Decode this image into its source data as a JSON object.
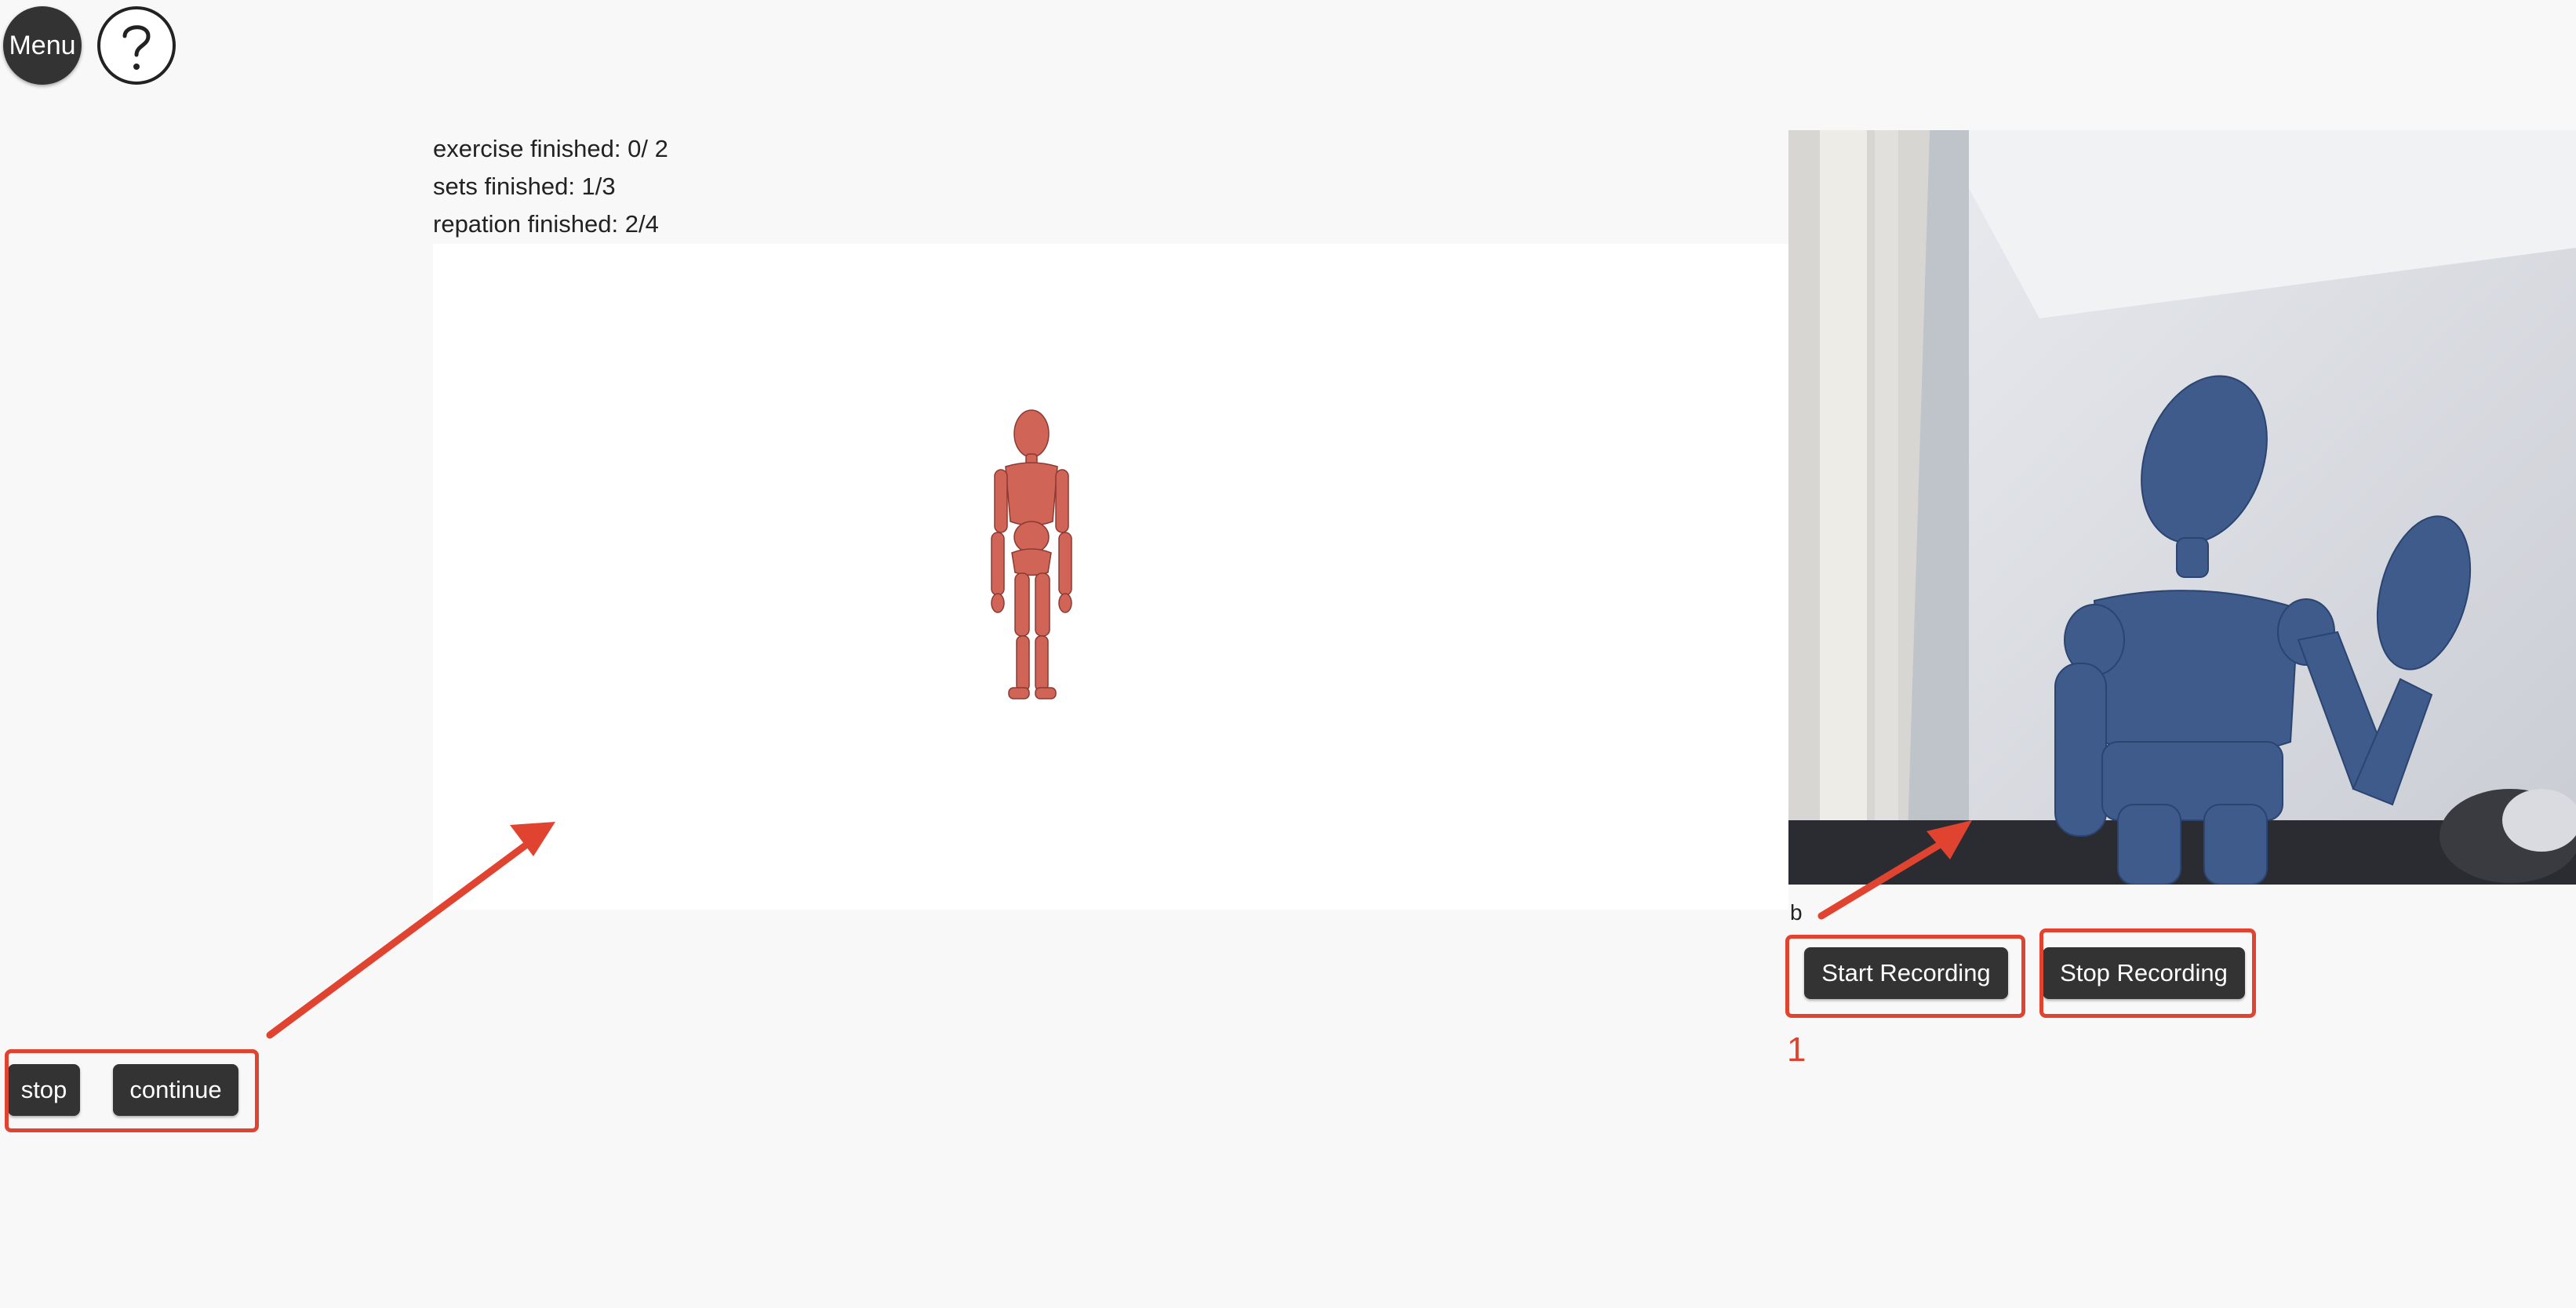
{
  "header": {
    "menu_label": "Menu",
    "help_icon": "question-circle-icon"
  },
  "stats": {
    "exercise": "exercise finished: 0/ 2",
    "sets": "sets finished: 1/3",
    "repetition": "repation finished: 2/4"
  },
  "controls": {
    "stop_label": "stop",
    "continue_label": "continue"
  },
  "camera": {
    "label": "b",
    "start_label": "Start Recording",
    "stop_label": "Stop Recording"
  },
  "annotations": {
    "step_number": "1",
    "accent_color": "#e0432f"
  },
  "colors": {
    "page_bg": "#f8f8f8",
    "button_bg": "#333333",
    "avatar": "#d1685c",
    "mannequin": "#3e5b8c"
  }
}
